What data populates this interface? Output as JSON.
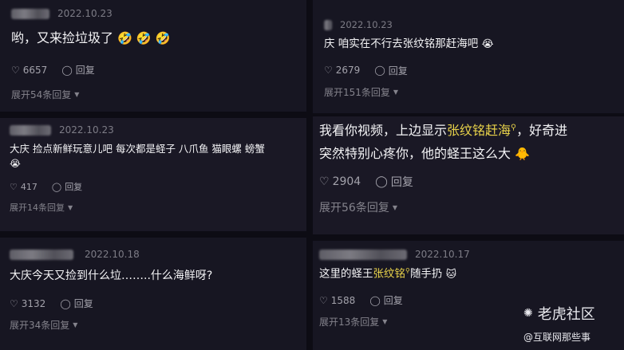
{
  "panels": {
    "top_left": {
      "date": "2022.10.23",
      "text": "哟，又来捡垃圾了",
      "emojis": "🤣 🤣 🤣",
      "likes": "6657",
      "reply_label": "回复",
      "expand": "展开54条回复"
    },
    "mid_left": {
      "date": "2022.10.23",
      "line1": "大庆  捡点新鲜玩意儿吧  每次都是蛏子  八爪鱼  猫眼螺  螃蟹",
      "line2_emoji": "😭",
      "likes": "417",
      "reply_label": "回复",
      "expand": "展开14条回复"
    },
    "bottom_left": {
      "date": "2022.10.18",
      "text": "大庆今天又捡到什么垃……..什么海鲜呀?",
      "likes": "3132",
      "reply_label": "回复",
      "expand": "展开34条回复"
    },
    "top_right": {
      "date": "2022.10.23",
      "text": "庆  咱实在不行去张纹铭那赶海吧",
      "emoji": "😭",
      "likes": "2679",
      "reply_label": "回复",
      "expand": "展开151条回复"
    },
    "mid_right": {
      "line1_a": "我看你视频，上边显示",
      "line1_hl": "张纹铭赶海",
      "line1_b": "，好奇进",
      "line2": "突然特别心疼你，他的蛏王这么大",
      "line2_emoji": "🐥",
      "likes": "2904",
      "reply_label": "回复",
      "expand": "展开56条回复"
    },
    "bottom_right": {
      "date": "2022.10.17",
      "text_a": "这里的蛏王",
      "text_hl": "张纹铭",
      "text_b": "随手扔",
      "emoji": "🐱",
      "likes": "1588",
      "reply_label": "回复",
      "expand": "展开13条回复"
    }
  },
  "watermark": {
    "brand": "老虎社区",
    "handle": "@互联网那些事"
  },
  "colors": {
    "background": "#171622",
    "highlight": "#e8d24a",
    "muted": "#84838c"
  }
}
